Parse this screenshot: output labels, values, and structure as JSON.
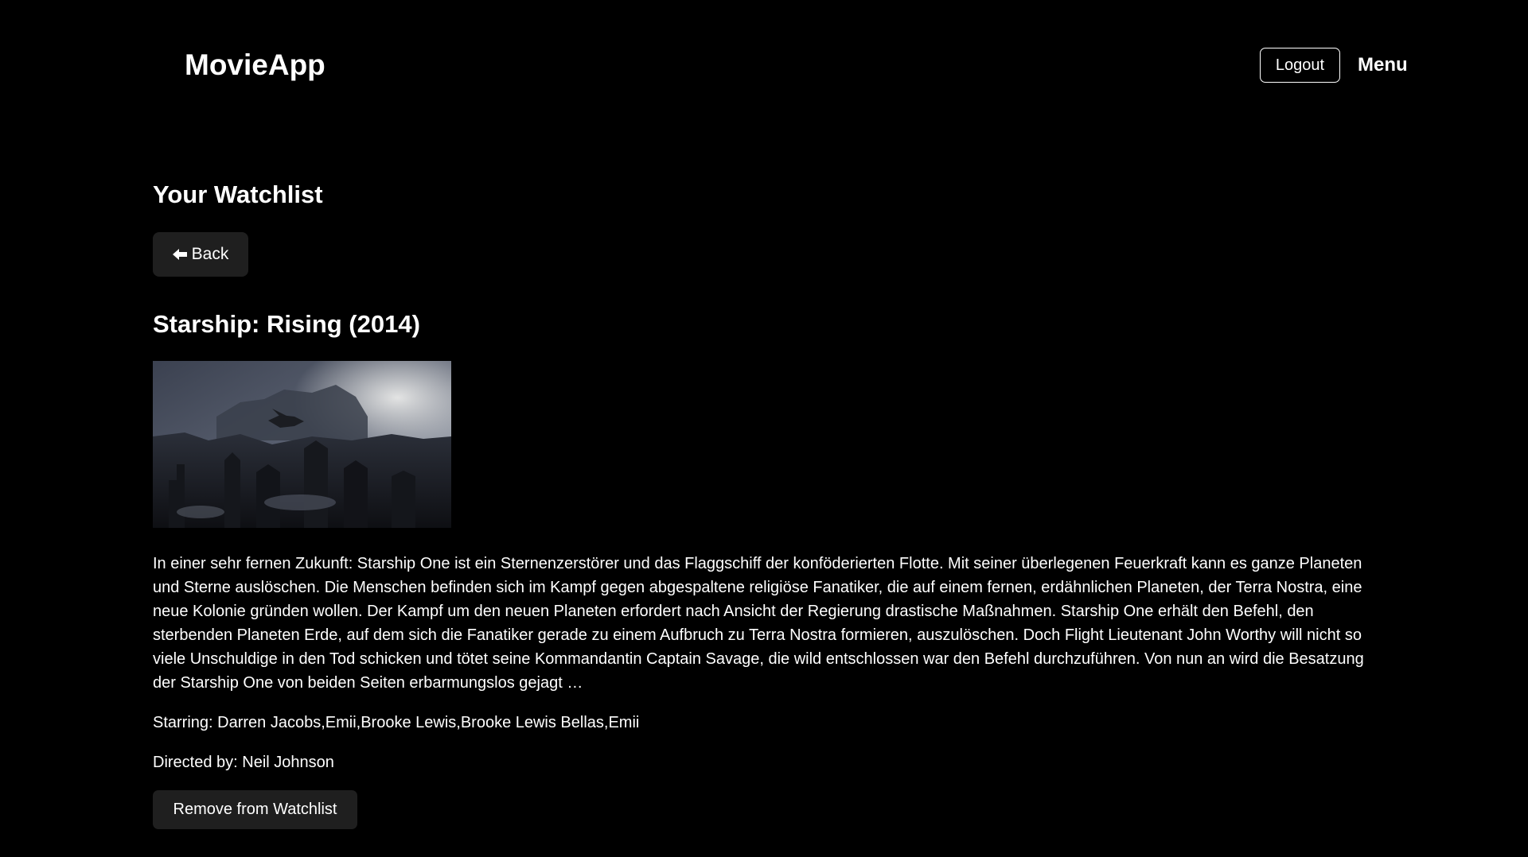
{
  "header": {
    "app_title": "MovieApp",
    "logout_label": "Logout",
    "menu_label": "Menu"
  },
  "main": {
    "page_title": "Your Watchlist",
    "back_label": "Back",
    "back_icon": "arrow-left-icon",
    "movie": {
      "title": "Starship: Rising (2014)",
      "description": "In einer sehr fernen Zukunft: Starship One ist ein Sternenzerstörer und das Flaggschiff der konföderierten Flotte. Mit seiner überlegenen Feuerkraft kann es ganze Planeten und Sterne auslöschen. Die Menschen befinden sich im Kampf gegen abgespaltene religiöse Fanatiker, die auf einem fernen, erdähnlichen Planeten, der Terra Nostra, eine neue Kolonie gründen wollen. Der Kampf um den neuen Planeten erfordert nach Ansicht der Regierung drastische Maßnahmen. Starship One erhält den Befehl, den sterbenden Planeten Erde, auf dem sich die Fanatiker gerade zu einem Aufbruch zu Terra Nostra formieren, auszulöschen. Doch Flight Lieutenant John Worthy will nicht so viele Unschuldige in den Tod schicken und tötet seine Kommandantin Captain Savage, die wild entschlossen war den Befehl durchzuführen. Von nun an wird die Besatzung der Starship One von beiden Seiten erbarmungslos gejagt …",
      "starring": "Starring: Darren Jacobs,Emii,Brooke Lewis,Brooke Lewis Bellas,Emii",
      "directed_by": "Directed by: Neil Johnson",
      "remove_label": "Remove from Watchlist"
    }
  },
  "colors": {
    "background": "#000000",
    "text": "#ffffff",
    "button_bg": "#1f1f1f"
  }
}
